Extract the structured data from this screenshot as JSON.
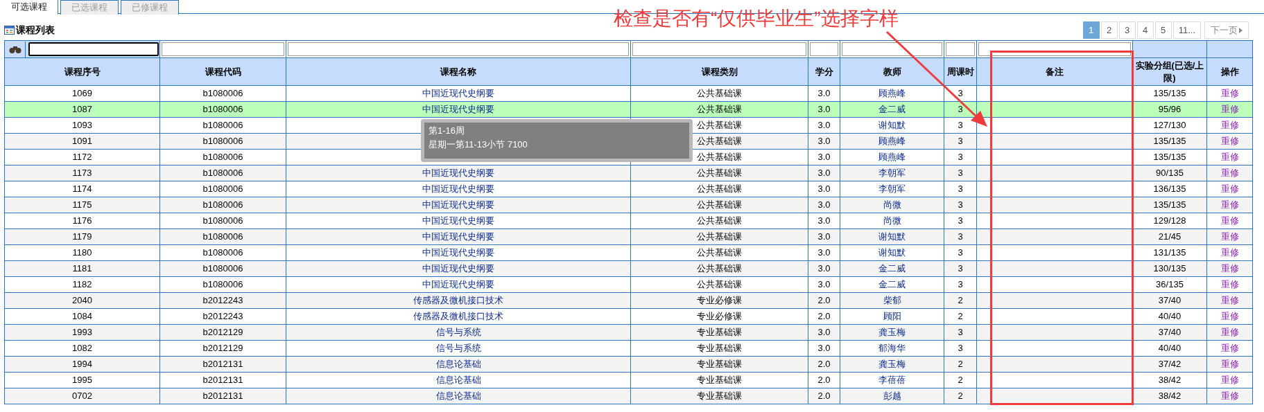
{
  "tabs": [
    {
      "label": "可选课程",
      "selected": true
    },
    {
      "label": "已选课程",
      "selected": false
    },
    {
      "label": "已修课程",
      "selected": false
    }
  ],
  "section_title": "课程列表",
  "pagination": [
    {
      "label": "1",
      "selected": true
    },
    {
      "label": "2",
      "selected": false
    },
    {
      "label": "3",
      "selected": false
    },
    {
      "label": "4",
      "selected": false
    },
    {
      "label": "5",
      "selected": false
    },
    {
      "label": "11...",
      "selected": false
    }
  ],
  "next_page": "下一页",
  "table": {
    "columns": [
      "课程序号",
      "课程代码",
      "课程名称",
      "课程类别",
      "学分",
      "教师",
      "周课时",
      "备注",
      "实验分组(已选/上限)",
      "操作"
    ],
    "rows": [
      {
        "id": "1069",
        "code": "b1080006",
        "name": "中国近现代史纲要",
        "category": "公共基础课",
        "credit": "3.0",
        "teacher": "顾燕峰",
        "hours": "3",
        "quota": "135/135",
        "action": "重修",
        "selected": false
      },
      {
        "id": "1087",
        "code": "b1080006",
        "name": "中国近现代史纲要",
        "category": "公共基础课",
        "credit": "3.0",
        "teacher": "金二威",
        "hours": "3",
        "quota": "95/96",
        "action": "重修",
        "selected": true
      },
      {
        "id": "1093",
        "code": "b1080006",
        "category": "公共基础课",
        "credit": "3.0",
        "teacher": "谢知默",
        "hours": "3",
        "quota": "127/130",
        "action": "重修",
        "selected": false
      },
      {
        "id": "1091",
        "code": "b1080006",
        "category": "公共基础课",
        "credit": "3.0",
        "teacher": "顾燕峰",
        "hours": "3",
        "quota": "135/135",
        "action": "重修",
        "selected": false
      },
      {
        "id": "1172",
        "code": "b1080006",
        "category": "公共基础课",
        "credit": "3.0",
        "teacher": "顾燕峰",
        "hours": "3",
        "quota": "135/135",
        "action": "重修",
        "selected": false
      },
      {
        "id": "1173",
        "code": "b1080006",
        "name": "中国近现代史纲要",
        "category": "公共基础课",
        "credit": "3.0",
        "teacher": "李朝军",
        "hours": "3",
        "quota": "90/135",
        "action": "重修",
        "selected": false
      },
      {
        "id": "1174",
        "code": "b1080006",
        "name": "中国近现代史纲要",
        "category": "公共基础课",
        "credit": "3.0",
        "teacher": "李朝军",
        "hours": "3",
        "quota": "136/135",
        "action": "重修",
        "selected": false
      },
      {
        "id": "1175",
        "code": "b1080006",
        "name": "中国近现代史纲要",
        "category": "公共基础课",
        "credit": "3.0",
        "teacher": "尚微",
        "hours": "3",
        "quota": "135/135",
        "action": "重修",
        "selected": false
      },
      {
        "id": "1176",
        "code": "b1080006",
        "name": "中国近现代史纲要",
        "category": "公共基础课",
        "credit": "3.0",
        "teacher": "尚微",
        "hours": "3",
        "quota": "129/128",
        "action": "重修",
        "selected": false
      },
      {
        "id": "1179",
        "code": "b1080006",
        "name": "中国近现代史纲要",
        "category": "公共基础课",
        "credit": "3.0",
        "teacher": "谢知默",
        "hours": "3",
        "quota": "21/45",
        "action": "重修",
        "selected": false
      },
      {
        "id": "1180",
        "code": "b1080006",
        "name": "中国近现代史纲要",
        "category": "公共基础课",
        "credit": "3.0",
        "teacher": "谢知默",
        "hours": "3",
        "quota": "131/135",
        "action": "重修",
        "selected": false
      },
      {
        "id": "1181",
        "code": "b1080006",
        "name": "中国近现代史纲要",
        "category": "公共基础课",
        "credit": "3.0",
        "teacher": "金二威",
        "hours": "3",
        "quota": "130/135",
        "action": "重修",
        "selected": false
      },
      {
        "id": "1182",
        "code": "b1080006",
        "name": "中国近现代史纲要",
        "category": "公共基础课",
        "credit": "3.0",
        "teacher": "金二威",
        "hours": "3",
        "quota": "36/135",
        "action": "重修",
        "selected": false
      },
      {
        "id": "2040",
        "code": "b2012243",
        "name": "传感器及微机接口技术",
        "category": "专业必修课",
        "credit": "2.0",
        "teacher": "柴郁",
        "hours": "2",
        "quota": "37/40",
        "action": "重修",
        "selected": false
      },
      {
        "id": "1084",
        "code": "b2012243",
        "name": "传感器及微机接口技术",
        "category": "专业必修课",
        "credit": "2.0",
        "teacher": "顾阳",
        "hours": "2",
        "quota": "40/40",
        "action": "重修",
        "selected": false
      },
      {
        "id": "1993",
        "code": "b2012129",
        "name": "信号与系统",
        "category": "专业基础课",
        "credit": "3.0",
        "teacher": "龚玉梅",
        "hours": "3",
        "quota": "37/40",
        "action": "重修",
        "selected": false
      },
      {
        "id": "1082",
        "code": "b2012129",
        "name": "信号与系统",
        "category": "专业基础课",
        "credit": "3.0",
        "teacher": "郁海华",
        "hours": "3",
        "quota": "40/40",
        "action": "重修",
        "selected": false
      },
      {
        "id": "1994",
        "code": "b2012131",
        "name": "信息论基础",
        "category": "专业基础课",
        "credit": "2.0",
        "teacher": "龚玉梅",
        "hours": "2",
        "quota": "37/42",
        "action": "重修",
        "selected": false
      },
      {
        "id": "1995",
        "code": "b2012131",
        "name": "信息论基础",
        "category": "专业基础课",
        "credit": "2.0",
        "teacher": "李蓓蓓",
        "hours": "2",
        "quota": "38/42",
        "action": "重修",
        "selected": false
      },
      {
        "id": "0702",
        "code": "b2012131",
        "name": "信息论基础",
        "category": "专业基础课",
        "credit": "2.0",
        "teacher": "彭越",
        "hours": "2",
        "quota": "38/42",
        "action": "重修",
        "selected": false
      }
    ]
  },
  "tooltip": [
    "第1-16周",
    "星期一第11-13小节 7100"
  ],
  "annotation": "检查是否有“仅供毕业生”选择字样"
}
